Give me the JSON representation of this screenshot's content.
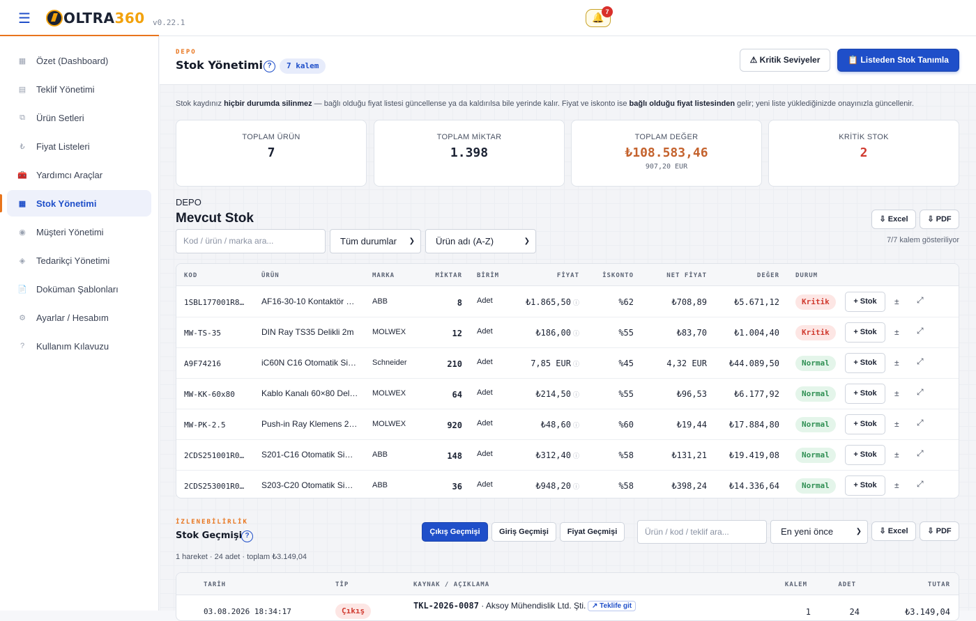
{
  "app": {
    "logo_a": "OLTRA",
    "logo_b": "360",
    "version": "v0.22.1",
    "notification_count": "7"
  },
  "sidebar": {
    "items": [
      {
        "icon": "▦",
        "label": "Özet (Dashboard)"
      },
      {
        "icon": "▤",
        "label": "Teklif Yönetimi"
      },
      {
        "icon": "⧉",
        "label": "Ürün Setleri"
      },
      {
        "icon": "₺",
        "label": "Fiyat Listeleri"
      },
      {
        "icon": "🧰",
        "label": "Yardımcı Araçlar"
      },
      {
        "icon": "▦",
        "label": "Stok Yönetimi"
      },
      {
        "icon": "◉",
        "label": "Müşteri Yönetimi"
      },
      {
        "icon": "◈",
        "label": "Tedarikçi Yönetimi"
      },
      {
        "icon": "📄",
        "label": "Doküman Şablonları"
      },
      {
        "icon": "⚙",
        "label": "Ayarlar / Hesabım"
      },
      {
        "icon": "?",
        "label": "Kullanım Kılavuzu"
      }
    ]
  },
  "header": {
    "eyebrow": "DEPO",
    "title": "Stok Yönetimi",
    "help": "?",
    "count_pill": "7 kalem",
    "critical_btn": "⚠ Kritik Seviyeler",
    "define_btn": "📋 Listeden Stok Tanımla"
  },
  "notice": {
    "p1": "Stok kaydınız ",
    "b1": "hiçbir durumda silinmez",
    "p2": " — bağlı olduğu fiyat listesi güncellense ya da kaldırılsa bile yerinde kalır. Fiyat ve iskonto ise ",
    "b2": "bağlı olduğu fiyat listesinden",
    "p3": " gelir; yeni liste yüklediğinizde onayınızla güncellenir."
  },
  "stats": [
    {
      "label": "TOPLAM ÜRÜN",
      "value": "7",
      "sub": "",
      "color": "#1b2233"
    },
    {
      "label": "TOPLAM MİKTAR",
      "value": "1.398",
      "sub": "",
      "color": "#1b2233"
    },
    {
      "label": "TOPLAM DEĞER",
      "value": "₺108.583,46",
      "sub": "907,20 EUR",
      "color": "#c4622d"
    },
    {
      "label": "KRİTİK STOK",
      "value": "2",
      "sub": "",
      "color": "#d03a2f"
    }
  ],
  "stock": {
    "section_label": "DEPO",
    "title": "Mevcut Stok",
    "excel": "⇩ Excel",
    "pdf": "⇩ PDF",
    "search_placeholder": "Kod / ürün / marka ara...",
    "status_filter": "Tüm durumlar",
    "sort": "Ürün adı (A-Z)",
    "count_note": "7/7 kalem gösteriliyor",
    "columns": [
      "KOD",
      "ÜRÜN",
      "MARKA",
      "MİKTAR",
      "BİRİM",
      "FİYAT",
      "İSKONTO",
      "NET FİYAT",
      "DEĞER",
      "DURUM"
    ],
    "add_label": "+ Stok",
    "adjust_icon": "±",
    "expand_icon": "⤢",
    "rows": [
      {
        "code": "1SBL177001R8…",
        "product": "AF16-30-10 Kontaktör …",
        "brand": "ABB",
        "qty": "8",
        "unit": "Adet",
        "price": "₺1.865,50",
        "discount": "%62",
        "net": "₺708,89",
        "value": "₺5.671,12",
        "status": "Kritik",
        "status_type": "kritik"
      },
      {
        "code": "MW-TS-35",
        "product": "DIN Ray TS35 Delikli 2m",
        "brand": "MOLWEX",
        "qty": "12",
        "unit": "Adet",
        "price": "₺186,00",
        "discount": "%55",
        "net": "₺83,70",
        "value": "₺1.004,40",
        "status": "Kritik",
        "status_type": "kritik"
      },
      {
        "code": "A9F74216",
        "product": "iC60N C16 Otomatik Si…",
        "brand": "Schneider",
        "qty": "210",
        "unit": "Adet",
        "price": "7,85 EUR",
        "discount": "%45",
        "net": "4,32 EUR",
        "value": "₺44.089,50",
        "status": "Normal",
        "status_type": "normal"
      },
      {
        "code": "MW-KK-60x80",
        "product": "Kablo Kanalı 60×80 Del…",
        "brand": "MOLWEX",
        "qty": "64",
        "unit": "Adet",
        "price": "₺214,50",
        "discount": "%55",
        "net": "₺96,53",
        "value": "₺6.177,92",
        "status": "Normal",
        "status_type": "normal"
      },
      {
        "code": "MW-PK-2.5",
        "product": "Push-in Ray Klemens 2…",
        "brand": "MOLWEX",
        "qty": "920",
        "unit": "Adet",
        "price": "₺48,60",
        "discount": "%60",
        "net": "₺19,44",
        "value": "₺17.884,80",
        "status": "Normal",
        "status_type": "normal"
      },
      {
        "code": "2CDS251001R0…",
        "product": "S201-C16 Otomatik Si…",
        "brand": "ABB",
        "qty": "148",
        "unit": "Adet",
        "price": "₺312,40",
        "discount": "%58",
        "net": "₺131,21",
        "value": "₺19.419,08",
        "status": "Normal",
        "status_type": "normal"
      },
      {
        "code": "2CDS253001R0…",
        "product": "S203-C20 Otomatik Si…",
        "brand": "ABB",
        "qty": "36",
        "unit": "Adet",
        "price": "₺948,20",
        "discount": "%58",
        "net": "₺398,24",
        "value": "₺14.336,64",
        "status": "Normal",
        "status_type": "normal"
      }
    ]
  },
  "history": {
    "eyebrow": "İZLENEBİLİRLİK",
    "title": "Stok Geçmişi",
    "help": "?",
    "tabs": [
      "Çıkış Geçmişi",
      "Giriş Geçmişi",
      "Fiyat Geçmişi"
    ],
    "search_placeholder": "Ürün / kod / teklif ara...",
    "sort": "En yeni önce",
    "excel": "⇩ Excel",
    "pdf": "⇩ PDF",
    "summary": "1 hareket · 24 adet · toplam ₺3.149,04",
    "columns": [
      "TARİH",
      "TİP",
      "KAYNAK / AÇIKLAMA",
      "KALEM",
      "ADET",
      "TUTAR"
    ],
    "row": {
      "date": "03.08.2026 18:34:17",
      "type": "Çıkış",
      "ref": "TKL-2026-0087",
      "company": " · Aksoy Mühendislik Ltd. Şti.",
      "link": "↗ Teklife git",
      "items": "1",
      "qty": "24",
      "total": "₺3.149,04"
    }
  }
}
